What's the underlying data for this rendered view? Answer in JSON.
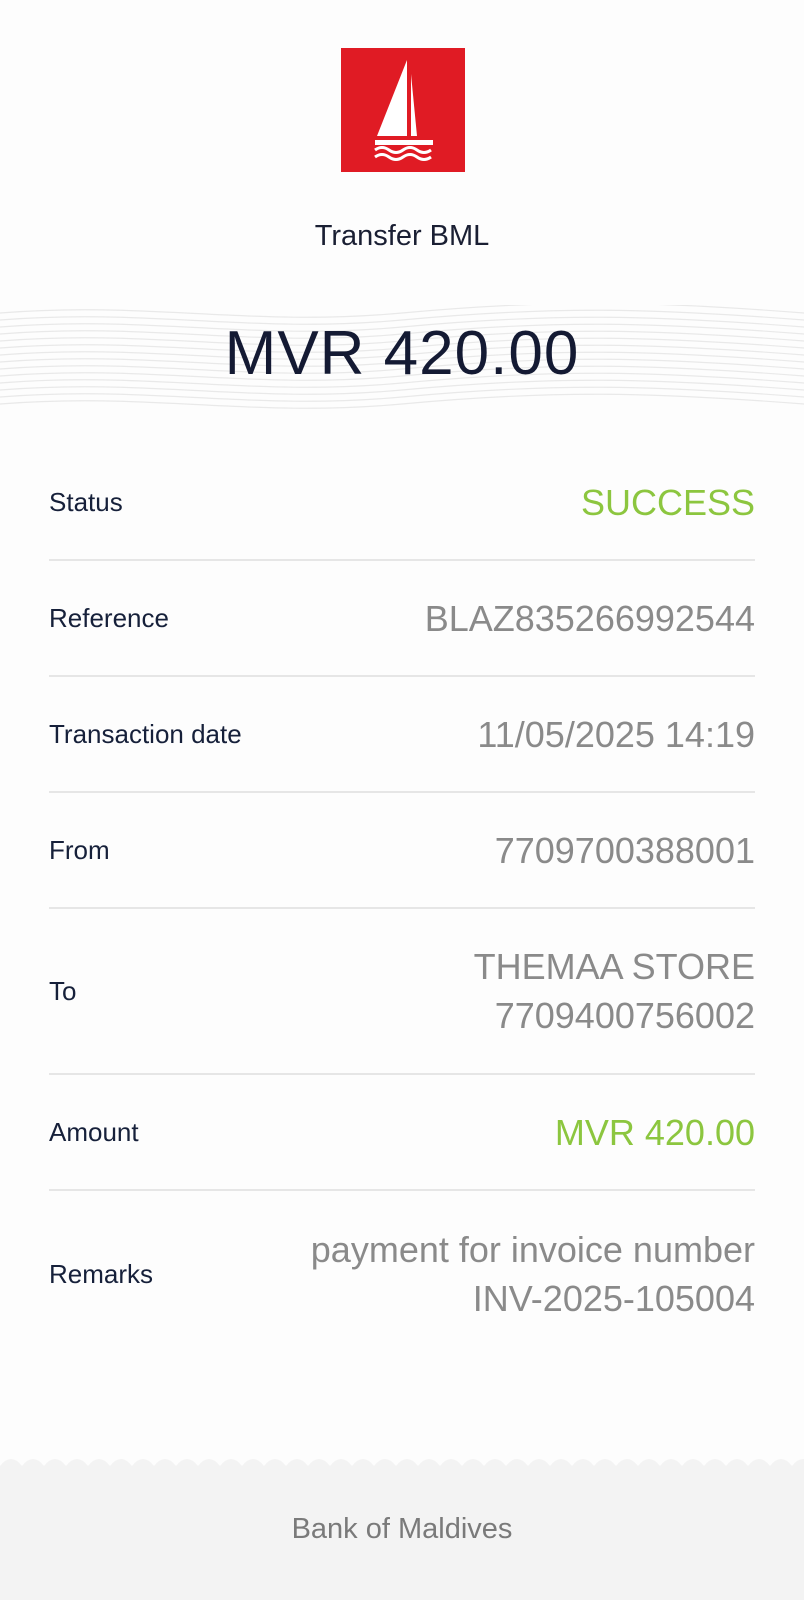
{
  "header": {
    "logo_icon": "bml-sailboat-logo",
    "title": "Transfer BML",
    "amount": "MVR 420.00"
  },
  "details": [
    {
      "label": "Status",
      "value": "SUCCESS",
      "value_color": "#8cc63f"
    },
    {
      "label": "Reference",
      "value": "BLAZ835266992544"
    },
    {
      "label": "Transaction date",
      "value": "11/05/2025 14:19"
    },
    {
      "label": "From",
      "value": "7709700388001"
    },
    {
      "label": "To",
      "value_line1": "THEMAA STORE",
      "value_line2": "7709400756002"
    },
    {
      "label": "Amount",
      "value": "MVR 420.00",
      "value_color": "#8cc63f"
    },
    {
      "label": "Remarks",
      "value_line1": "payment for invoice number",
      "value_line2": "INV-2025-105004"
    }
  ],
  "footer": {
    "text": "Bank of Maldives"
  },
  "colors": {
    "brand_red": "#e01b24",
    "success_green": "#8cc63f",
    "navy": "#141a33"
  }
}
